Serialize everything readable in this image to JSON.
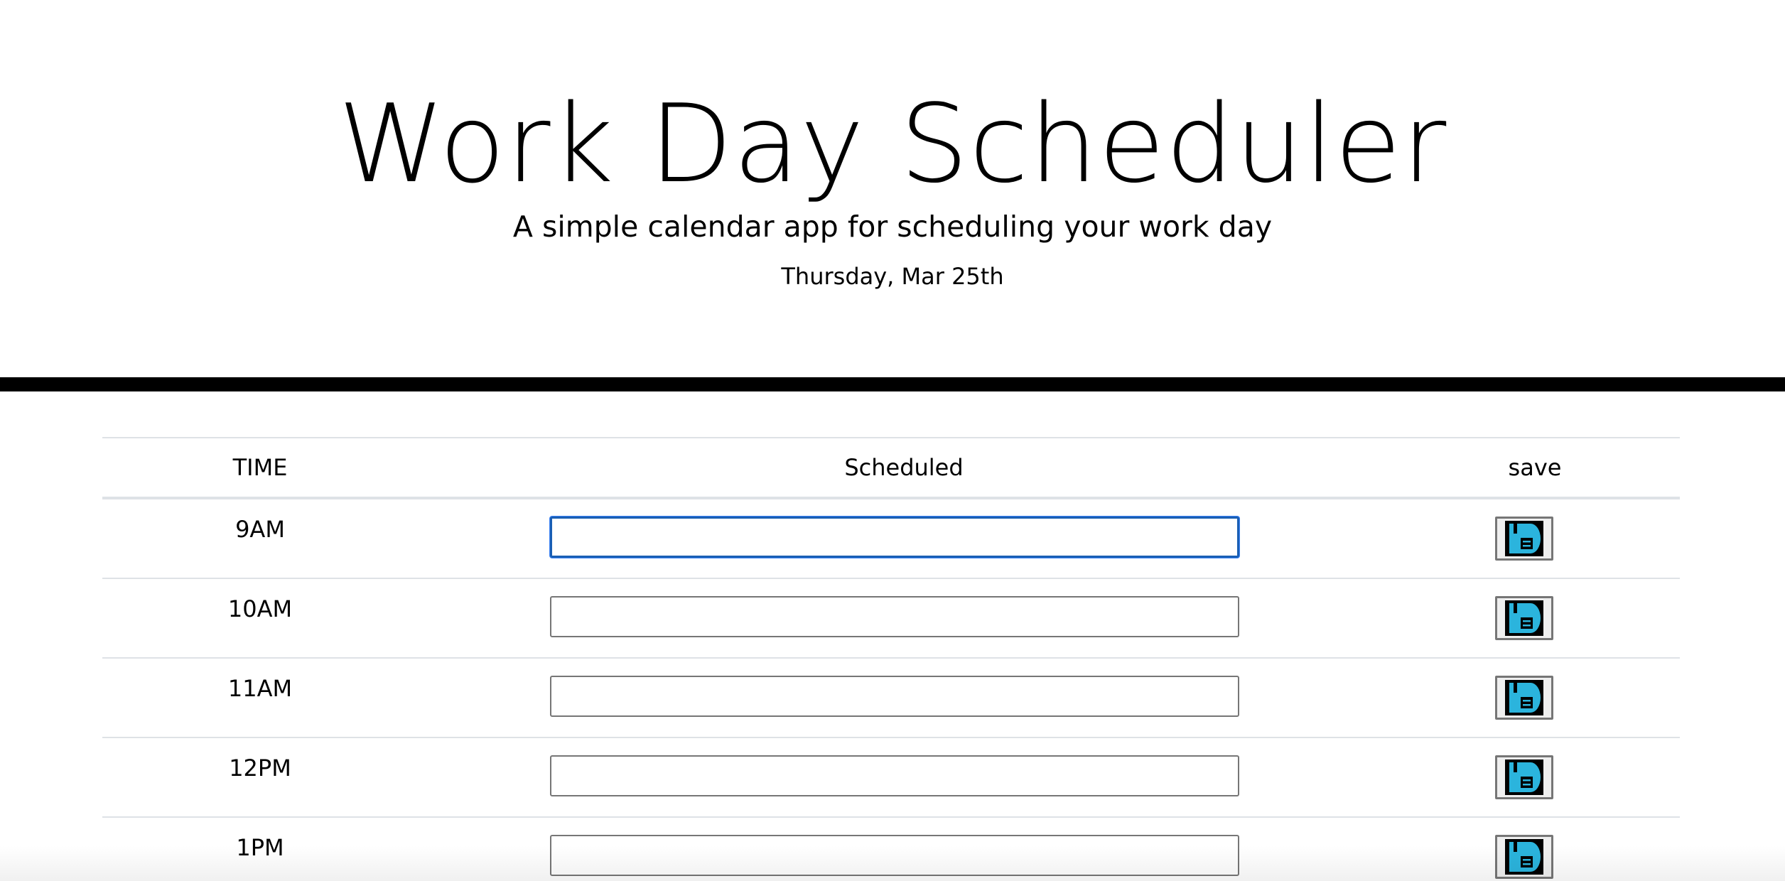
{
  "header": {
    "title": "Work Day Scheduler",
    "subtitle": "A simple calendar app for scheduling your work day",
    "date": "Thursday, Mar 25th"
  },
  "table": {
    "columns": {
      "time": "TIME",
      "scheduled": "Scheduled",
      "save": "save"
    },
    "rows": [
      {
        "time": "9AM",
        "value": "",
        "focused": true
      },
      {
        "time": "10AM",
        "value": ""
      },
      {
        "time": "11AM",
        "value": ""
      },
      {
        "time": "12PM",
        "value": ""
      },
      {
        "time": "1PM",
        "value": ""
      }
    ]
  },
  "icons": {
    "save": "floppy-disk-icon"
  },
  "colors": {
    "save_icon_accent": "#2bb4dd",
    "focus_ring": "#1a5fb4"
  }
}
